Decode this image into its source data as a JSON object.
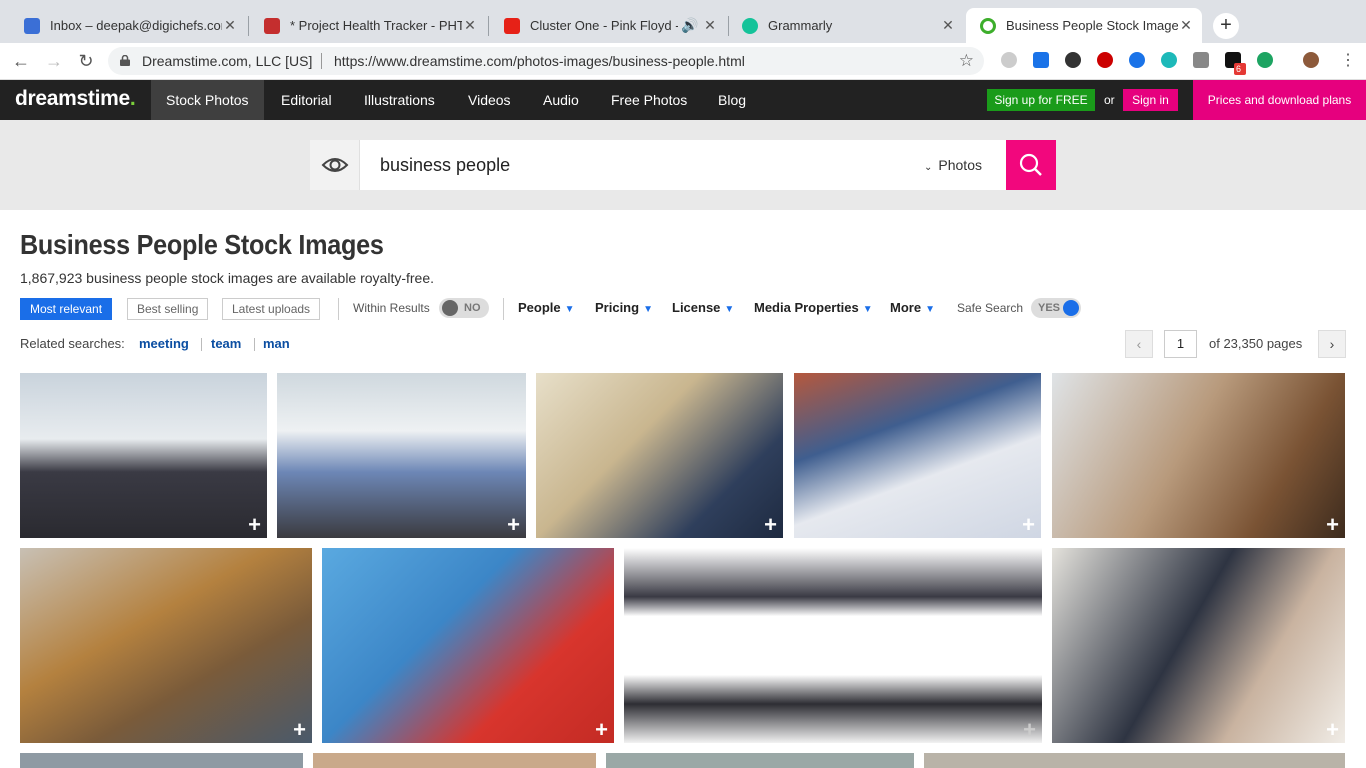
{
  "browser": {
    "tabs": [
      {
        "title": "Inbox – deepak@digichefs.com",
        "icon": "gmail-icon"
      },
      {
        "title": "* Project Health Tracker - PHT",
        "icon": "doc-icon"
      },
      {
        "title": "Cluster One - Pink Floyd -",
        "icon": "youtube-icon"
      },
      {
        "title": "Grammarly",
        "icon": "grammarly-icon"
      },
      {
        "title": "Business People Stock Images",
        "icon": "dreamstime-icon"
      }
    ],
    "site_identity": "Dreamstime.com, LLC [US]",
    "url": "https://www.dreamstime.com/photos-images/business-people.html",
    "extension_badge": "6"
  },
  "site_nav": {
    "logo": "dreamstime",
    "items": [
      "Stock Photos",
      "Editorial",
      "Illustrations",
      "Videos",
      "Audio",
      "Free Photos",
      "Blog"
    ],
    "signup": "Sign up for FREE",
    "or": "or",
    "signin": "Sign in",
    "prices": "Prices and download plans"
  },
  "search": {
    "query": "business people",
    "type": "Photos"
  },
  "page": {
    "title": "Business People Stock Images",
    "subtitle": "1,867,923 business people stock images are available royalty-free."
  },
  "filters": {
    "sort": [
      "Most relevant",
      "Best selling",
      "Latest uploads"
    ],
    "within_results": "Within Results",
    "within_state": "NO",
    "dropdowns": [
      "People",
      "Pricing",
      "License",
      "Media Properties",
      "More"
    ],
    "safe_search": "Safe Search",
    "safe_state": "YES"
  },
  "related": {
    "label": "Related searches:",
    "terms": [
      "meeting",
      "team",
      "man"
    ]
  },
  "pagination": {
    "current": "1",
    "of_text": "of 23,350 pages"
  },
  "thumbs_plus": "+",
  "colors": {
    "accent_pink": "#e6007e",
    "signup_green": "#1a9b1a",
    "active_blue": "#1a6ee8",
    "nav_bg": "#222222"
  }
}
